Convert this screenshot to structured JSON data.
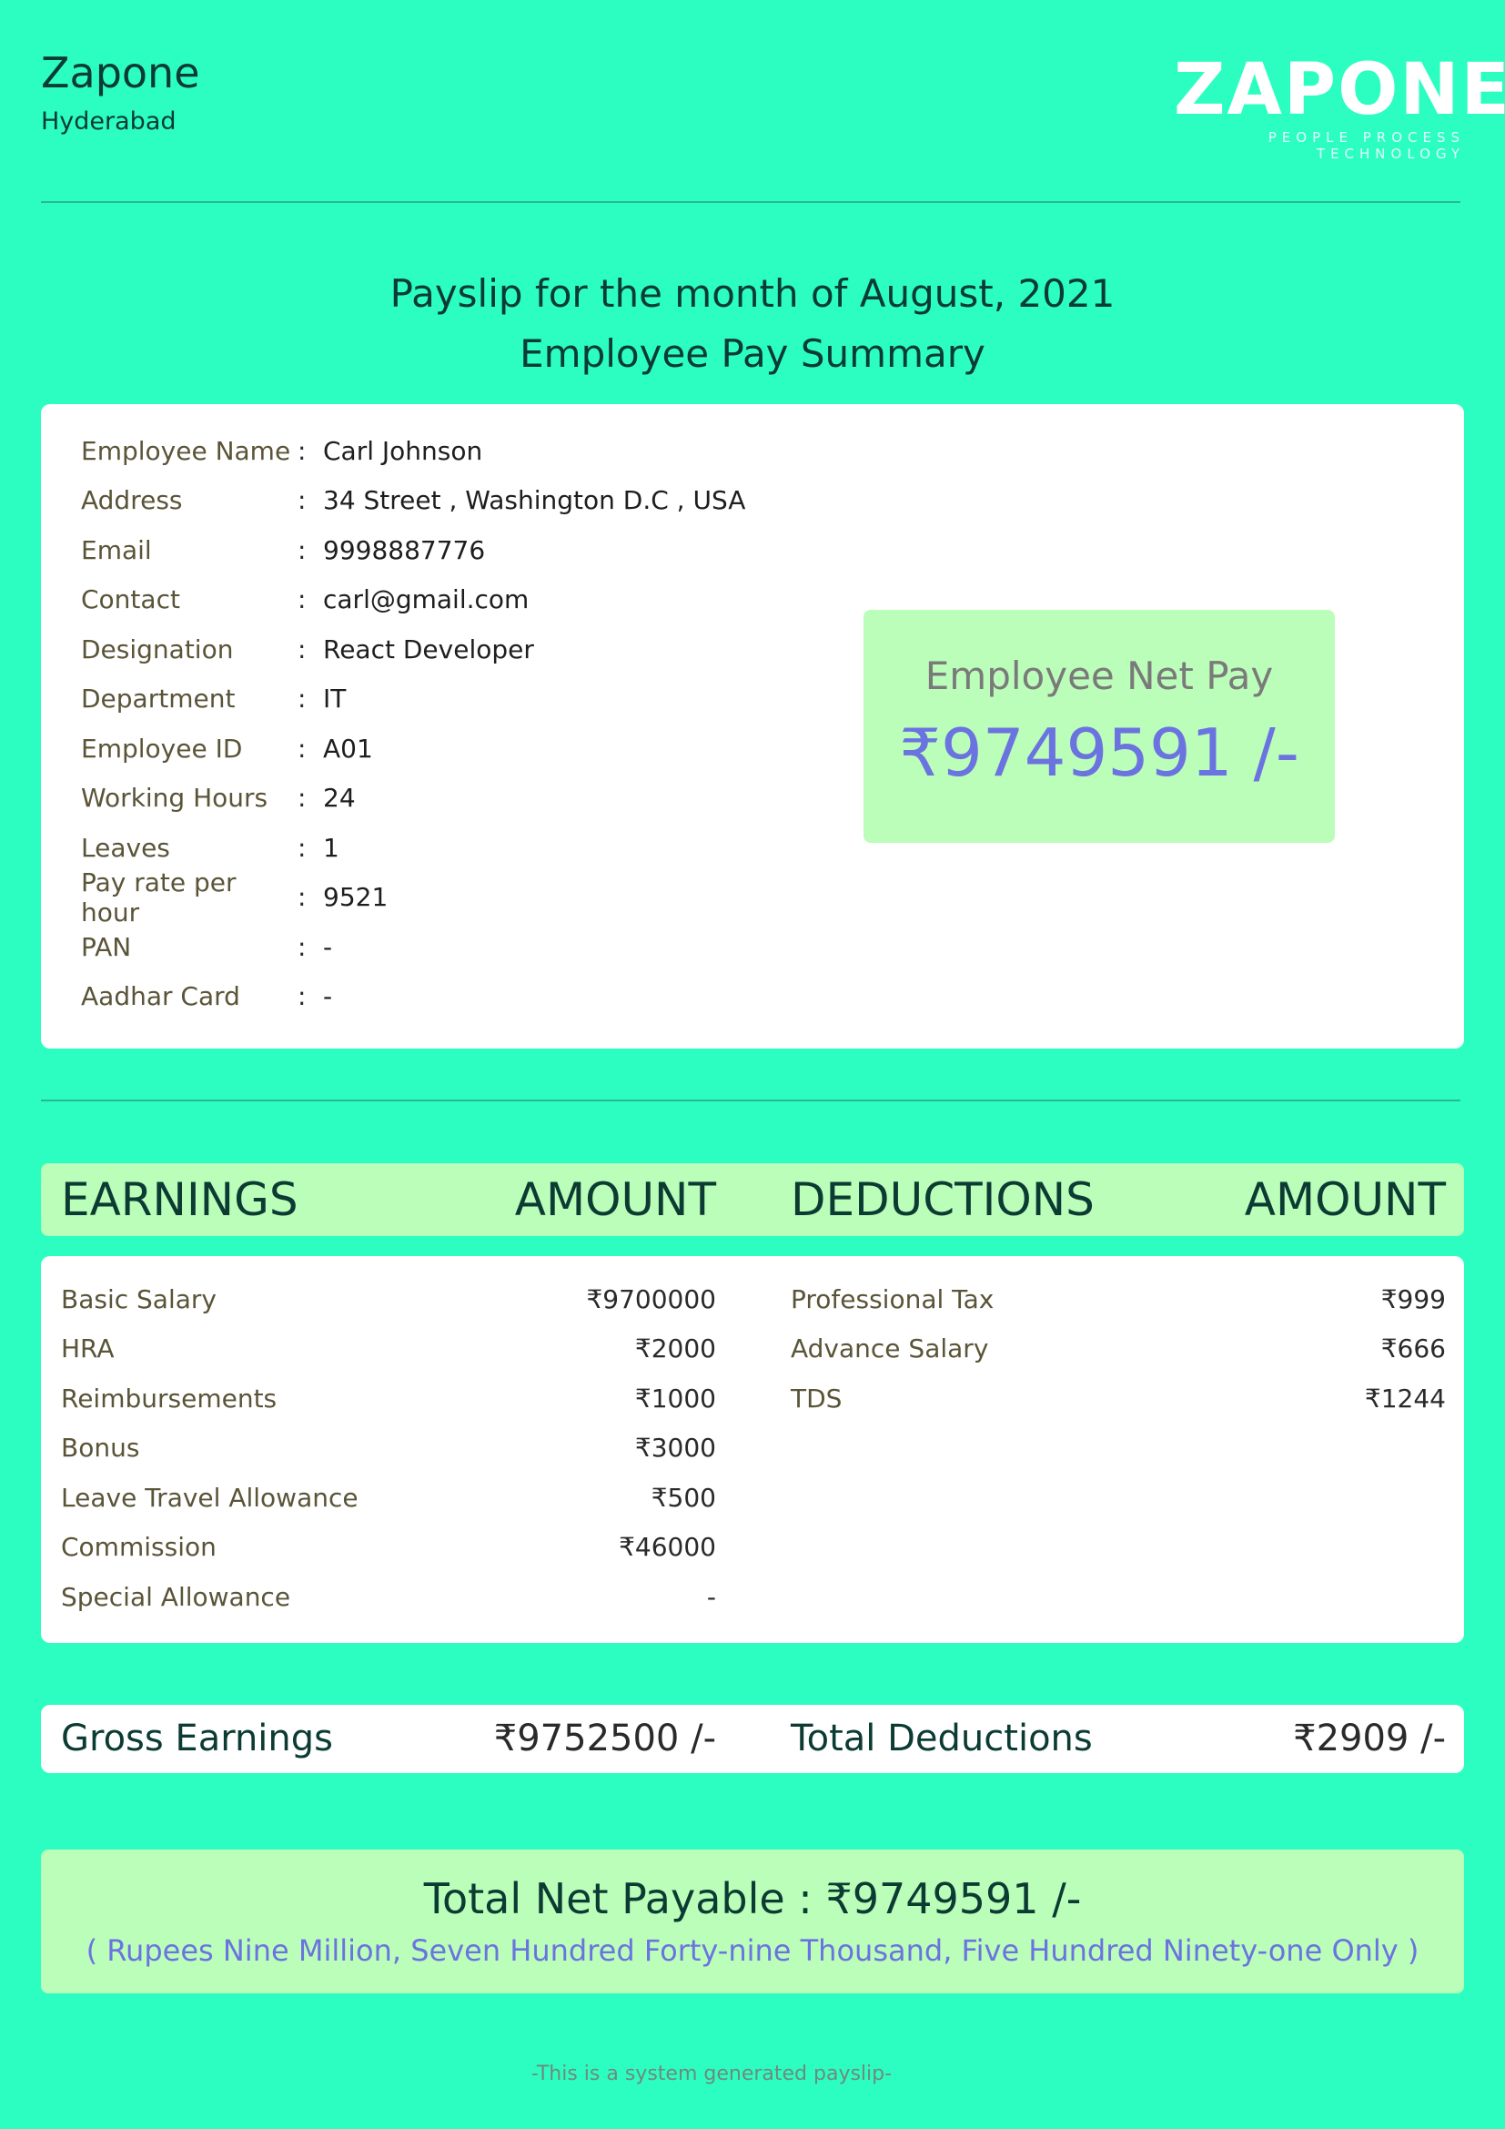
{
  "company": {
    "name": "Zapone",
    "city": "Hyderabad",
    "logo_text": "ZAPONE",
    "logo_tagline": "PEOPLE  PROCESS  TECHNOLOGY"
  },
  "title": {
    "line1": "Payslip for the month of August, 2021",
    "line2": "Employee Pay Summary"
  },
  "employee": [
    {
      "label": "Employee Name",
      "value": "Carl Johnson"
    },
    {
      "label": "Address",
      "value": "34 Street , Washington D.C , USA"
    },
    {
      "label": "Email",
      "value": "9998887776"
    },
    {
      "label": "Contact",
      "value": "carl@gmail.com"
    },
    {
      "label": "Designation",
      "value": "React Developer"
    },
    {
      "label": "Department",
      "value": "IT"
    },
    {
      "label": "Employee ID",
      "value": "A01"
    },
    {
      "label": "Working Hours",
      "value": "24"
    },
    {
      "label": "Leaves",
      "value": "1"
    },
    {
      "label": "Pay rate per hour",
      "value": "9521"
    },
    {
      "label": "PAN",
      "value": "-"
    },
    {
      "label": "Aadhar Card",
      "value": "-"
    }
  ],
  "colon": ":",
  "net_pay_box": {
    "label": "Employee Net Pay",
    "value": "₹9749591 /-"
  },
  "headers": {
    "earnings": "EARNINGS",
    "earnings_amount": "AMOUNT",
    "deductions": "DEDUCTIONS",
    "deductions_amount": "AMOUNT"
  },
  "earnings": [
    {
      "label": "Basic Salary",
      "amount": "₹9700000"
    },
    {
      "label": "HRA",
      "amount": "₹2000"
    },
    {
      "label": "Reimbursements",
      "amount": "₹1000"
    },
    {
      "label": "Bonus",
      "amount": "₹3000"
    },
    {
      "label": "Leave Travel Allowance",
      "amount": "₹500"
    },
    {
      "label": "Commission",
      "amount": "₹46000"
    },
    {
      "label": "Special Allowance",
      "amount": "-"
    }
  ],
  "deductions": [
    {
      "label": "Professional Tax",
      "amount": "₹999"
    },
    {
      "label": "Advance Salary",
      "amount": "₹666"
    },
    {
      "label": "TDS",
      "amount": "₹1244"
    }
  ],
  "totals": {
    "gross_label": "Gross Earnings",
    "gross_value": "₹9752500 /-",
    "deductions_label": "Total Deductions",
    "deductions_value": "₹2909 /-"
  },
  "net_payable": {
    "label": "Total Net Payable :",
    "value": "₹9749591 /-",
    "words": "( Rupees Nine Million, Seven Hundred Forty-nine Thousand, Five Hundred Ninety-one Only )"
  },
  "footer": "-This is a system generated payslip-",
  "colors": {
    "page_bg": "#2cfec1",
    "highlight_bg": "#bbfeb9",
    "accent": "#6b73e0",
    "heading": "#0b3b32"
  }
}
